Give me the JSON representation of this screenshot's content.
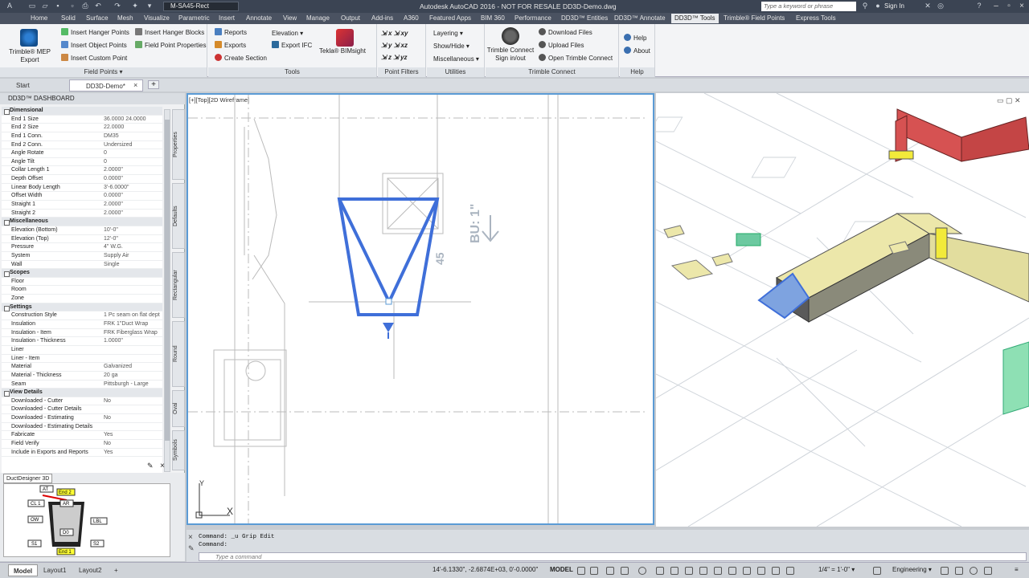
{
  "titlebar": {
    "workspace": "M-SA45-Rect",
    "app_title": "Autodesk AutoCAD 2016 - NOT FOR RESALE    DD3D-Demo.dwg",
    "search_placeholder": "Type a keyword or phrase",
    "sign_in": "Sign In"
  },
  "ribbon_tabs": [
    "Home",
    "Solid",
    "Surface",
    "Mesh",
    "Visualize",
    "Parametric",
    "Insert",
    "Annotate",
    "View",
    "Manage",
    "Output",
    "Add-ins",
    "A360",
    "Featured Apps",
    "BIM 360",
    "Performance",
    "DD3D™ Entities",
    "DD3D™ Annotate",
    "DD3D™ Tools",
    "Trimble® Field Points",
    "Express Tools"
  ],
  "active_ribbon_tab": "DD3D™ Tools",
  "ribbon": {
    "field_points": {
      "title": "Field Points",
      "export_label": "Trimble® MEP Export",
      "col1": [
        "Insert Hanger Points",
        "Insert Object Points",
        "Insert Custom Point"
      ],
      "col2": [
        "Insert Hanger Blocks",
        "Field Point Properties"
      ]
    },
    "tools": {
      "title": "Tools",
      "items": [
        "Reports",
        "Exports",
        "Create Section"
      ],
      "elevation": "Elevation",
      "export_ifc": "Export IFC",
      "tekla": "Tekla® BIMsight"
    },
    "point_filters": {
      "title": "Point Filters",
      "labels": [
        "x",
        "y",
        "z",
        "xy",
        "xz",
        "yz"
      ]
    },
    "utilities": {
      "title": "Utilities",
      "items": [
        "Layering",
        "Show/Hide",
        "Miscellaneous"
      ]
    },
    "trimble_connect": {
      "title": "Trimble Connect",
      "signin": "Trimble Connect Sign in/out",
      "items": [
        "Download Files",
        "Upload Files",
        "Open Trimble Connect"
      ]
    },
    "help": {
      "title": "Help",
      "items": [
        "Help",
        "About"
      ]
    }
  },
  "doc_tabs": [
    "Start",
    "DD3D-Demo*"
  ],
  "palette": {
    "title": "DD3D™ DASHBOARD",
    "vertical_tabs": [
      "Properties",
      "Defaults",
      "Rectangular",
      "Round",
      "Oval",
      "Symbols"
    ],
    "rows": [
      {
        "cat": true,
        "label": "Dimensional"
      },
      {
        "label": "End 1 Size",
        "value": "36.0000     24.0000"
      },
      {
        "label": "End 2 Size",
        "value": "22.0000"
      },
      {
        "label": "End 1 Conn.",
        "value": "DM35"
      },
      {
        "label": "End 2 Conn.",
        "value": "Undersized"
      },
      {
        "label": "Angle Rotate",
        "value": "0"
      },
      {
        "label": "Angle Tilt",
        "value": "0"
      },
      {
        "label": "Collar Length 1",
        "value": "2.0000\""
      },
      {
        "label": "Depth Offset",
        "value": "0.0000\""
      },
      {
        "label": "Linear Body Length",
        "value": "3'-6.0000\""
      },
      {
        "label": "Offset Width",
        "value": "0.0000\""
      },
      {
        "label": "Straight 1",
        "value": "2.0000\""
      },
      {
        "label": "Straight 2",
        "value": "2.0000\""
      },
      {
        "cat": true,
        "label": "Miscellaneous"
      },
      {
        "label": "Elevation (Bottom)",
        "value": "10'-0\""
      },
      {
        "label": "Elevation (Top)",
        "value": "12'-0\""
      },
      {
        "label": "Pressure",
        "value": "4\" W.G."
      },
      {
        "label": "System",
        "value": "Supply Air"
      },
      {
        "label": "Wall",
        "value": "Single"
      },
      {
        "cat": true,
        "label": "Scopes"
      },
      {
        "label": "Floor",
        "value": ""
      },
      {
        "label": "Room",
        "value": ""
      },
      {
        "label": "Zone",
        "value": ""
      },
      {
        "cat": true,
        "label": "Settings"
      },
      {
        "label": "Construction Style",
        "value": "1 Pc seam on flat dept"
      },
      {
        "label": "Insulation",
        "value": "FRK 1\"Duct Wrap"
      },
      {
        "label": "Insulation - Item",
        "value": "FRK Fiberglass Wrap"
      },
      {
        "label": "Insulation - Thickness",
        "value": "1.0000\""
      },
      {
        "label": "Liner",
        "value": ""
      },
      {
        "label": "Liner - Item",
        "value": ""
      },
      {
        "label": "Material",
        "value": "Galvanized"
      },
      {
        "label": "Material - Thickness",
        "value": "20 ga"
      },
      {
        "label": "Seam",
        "value": "Pittsburgh - Large"
      },
      {
        "cat": true,
        "label": "View Details"
      },
      {
        "label": "Downloaded - Cutter",
        "value": "No"
      },
      {
        "label": "Downloaded - Cutter Details",
        "value": ""
      },
      {
        "label": "Downloaded - Estimating",
        "value": "No"
      },
      {
        "label": "Downloaded - Estimating Details",
        "value": ""
      },
      {
        "label": "Fabricate",
        "value": "Yes"
      },
      {
        "label": "Field Verify",
        "value": "No"
      },
      {
        "label": "Include in Exports and Reports",
        "value": "Yes"
      }
    ]
  },
  "ductdesigner": {
    "tab": "DuctDesigner 3D",
    "labels": [
      "AT",
      "End 2",
      "CL 1",
      "AR",
      "LBL",
      "OW",
      "D0",
      "S1",
      "S2",
      "End 1"
    ]
  },
  "viewport_left": {
    "label": "[+][Top][2D Wireframe]",
    "annotations": [
      "BU: 1\"",
      "45"
    ],
    "ucs_x": "X",
    "ucs_y": "Y"
  },
  "command": {
    "history": [
      "Command: _u Grip Edit",
      "Command:"
    ],
    "placeholder": "Type a command"
  },
  "layout_tabs": [
    "Model",
    "Layout1",
    "Layout2"
  ],
  "status": {
    "coords": "14'-6.1330\", -2.6874E+03, 0'-0.0000\"",
    "space": "MODEL",
    "scale": "1/4\" = 1'-0\"",
    "workspace": "Engineering"
  },
  "colors": {
    "accent": "#5b9bd5",
    "selection": "#3f6fd9",
    "duct_yellow": "#e7e2a0",
    "duct_red": "#d9534f",
    "titlebar": "#3b4453"
  }
}
